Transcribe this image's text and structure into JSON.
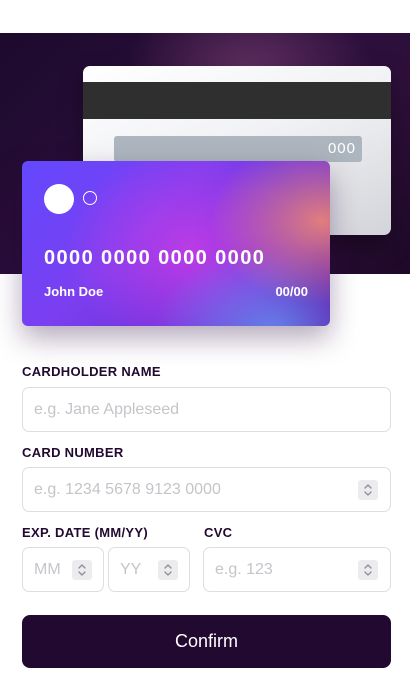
{
  "card_back": {
    "cvc": "000"
  },
  "card_front": {
    "number": "0000 0000 0000 0000",
    "name": "John Doe",
    "expiry": "00/00"
  },
  "form": {
    "cardholder_name": {
      "label": "CARDHOLDER NAME",
      "placeholder": "e.g. Jane Appleseed"
    },
    "card_number": {
      "label": "CARD NUMBER",
      "placeholder": "e.g. 1234 5678 9123 0000"
    },
    "exp_date": {
      "label": "EXP. DATE (MM/YY)",
      "month_placeholder": "MM",
      "year_placeholder": "YY"
    },
    "cvc": {
      "label": "CVC",
      "placeholder": "e.g. 123"
    },
    "confirm_label": "Confirm"
  },
  "icons": {
    "spinner": "stepper-arrows-icon"
  },
  "colors": {
    "primary_dark": "#21092f",
    "border": "#dedddf",
    "placeholder": "#c6c4c9"
  }
}
